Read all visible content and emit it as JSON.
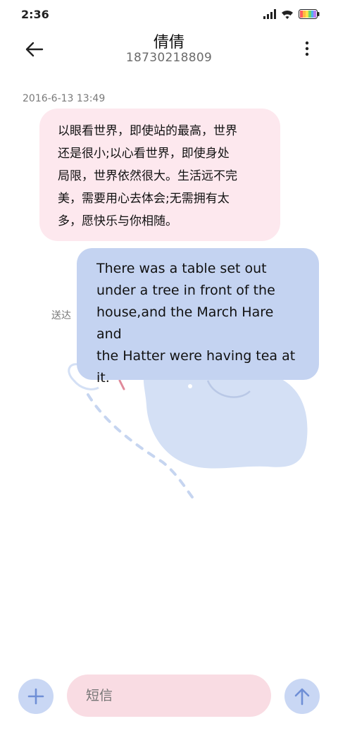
{
  "status_bar": {
    "time": "2:36",
    "icons": [
      "signal-icon",
      "wifi-icon",
      "battery-icon"
    ]
  },
  "header": {
    "back_icon": "back-arrow-icon",
    "contact_name": "倩倩",
    "contact_number": "18730218809",
    "more_icon": "more-vertical-icon"
  },
  "conversation": {
    "timestamp": "2016-6-13 13:49",
    "messages": [
      {
        "direction": "incoming",
        "lines": [
          "以眼看世界，即使站的最高，世界",
          "还是很小;以心看世界，即使身处",
          "局限，世界依然很大。生活远不完",
          "美，需要用心去体会;无需拥有太",
          "多，愿快乐与你相随。"
        ]
      },
      {
        "direction": "outgoing",
        "lines": [
          "There was a table set out",
          "under a tree in front of the",
          "house,and the March Hare and",
          "the Hatter were having tea at",
          "it."
        ],
        "status": "送达"
      }
    ]
  },
  "compose": {
    "add_icon": "plus-icon",
    "placeholder": "短信",
    "send_icon": "send-arrow-up-icon"
  },
  "colors": {
    "incoming_bubble": "#fde8ee",
    "outgoing_bubble": "#c4d3f1",
    "input_background": "#f9dce3",
    "round_buttons": "#c9d7f4",
    "icon_accent": "#6f8fd6"
  }
}
